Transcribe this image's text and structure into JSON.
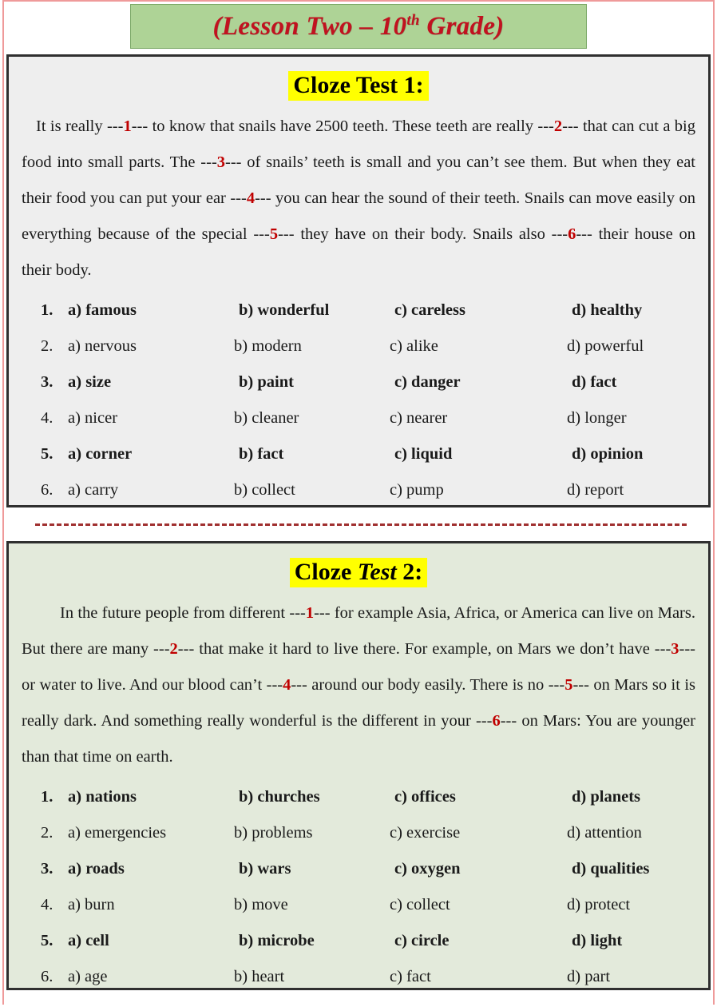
{
  "page": {
    "title_prefix": "(Lesson Two – 10",
    "title_sup": "th",
    "title_suffix": " Grade)"
  },
  "test1": {
    "heading_part1": "Cloze Test 1:",
    "passage": [
      {
        "t": "It is really ---"
      },
      {
        "n": "1"
      },
      {
        "t": "--- to know that snails have 2500 teeth. These teeth are really ---"
      },
      {
        "n": "2"
      },
      {
        "t": "--- that can cut a big food into small parts. The ---"
      },
      {
        "n": "3"
      },
      {
        "t": "--- of snails’ teeth is small and you can’t see them. But when they eat their food you can put your ear ---"
      },
      {
        "n": "4"
      },
      {
        "t": "--- you can hear the sound of their teeth. Snails can move easily on everything because of the special ---"
      },
      {
        "n": "5"
      },
      {
        "t": "--- they have on their body. Snails also ---"
      },
      {
        "n": "6"
      },
      {
        "t": "--- their house on their body."
      }
    ],
    "options": [
      {
        "num": "1.",
        "bold": true,
        "a": "a) famous",
        "b": "b) wonderful",
        "c": "c) careless",
        "d": "d) healthy"
      },
      {
        "num": "2.",
        "bold": false,
        "a": "a) nervous",
        "b": "b) modern",
        "c": "c) alike",
        "d": "d) powerful"
      },
      {
        "num": "3.",
        "bold": true,
        "a": "a) size",
        "b": "b) paint",
        "c": "c) danger",
        "d": "d) fact"
      },
      {
        "num": "4.",
        "bold": false,
        "a": "a) nicer",
        "b": "b) cleaner",
        "c": "c) nearer",
        "d": "d) longer"
      },
      {
        "num": "5.",
        "bold": true,
        "a": "a) corner",
        "b": "b) fact",
        "c": "c) liquid",
        "d": "d) opinion"
      },
      {
        "num": "6.",
        "bold": false,
        "a": "a) carry",
        "b": "b) collect",
        "c": "c) pump",
        "d": "d) report"
      }
    ]
  },
  "test2": {
    "heading_word1": "Cloze ",
    "heading_word2": "Test",
    "heading_word3": " 2:",
    "passage": [
      {
        "t": "In the future people from different ---"
      },
      {
        "n": "1"
      },
      {
        "t": "--- for example Asia, Africa, or America can live on Mars. But there are many ---"
      },
      {
        "n": "2"
      },
      {
        "t": "--- that make it hard to live there. For example, on Mars we don’t have ---"
      },
      {
        "n": "3"
      },
      {
        "t": "--- or water to live. And our blood can’t ---"
      },
      {
        "n": "4"
      },
      {
        "t": "--- around our body easily. There is no ---"
      },
      {
        "n": "5"
      },
      {
        "t": "--- on Mars so it is really dark. And something really wonderful is the different in your ---"
      },
      {
        "n": "6"
      },
      {
        "t": "--- on Mars: You are younger than that time on earth."
      }
    ],
    "options": [
      {
        "num": "1.",
        "bold": true,
        "a": "a) nations",
        "b": "b) churches",
        "c": "c) offices",
        "d": "d) planets"
      },
      {
        "num": "2.",
        "bold": false,
        "a": "a) emergencies",
        "b": "b) problems",
        "c": "c) exercise",
        "d": "d) attention"
      },
      {
        "num": "3.",
        "bold": true,
        "a": "a) roads",
        "b": "b) wars",
        "c": "c) oxygen",
        "d": "d) qualities"
      },
      {
        "num": "4.",
        "bold": false,
        "a": "a) burn",
        "b": "b) move",
        "c": "c) collect",
        "d": "d) protect"
      },
      {
        "num": "5.",
        "bold": true,
        "a": "a) cell",
        "b": "b) microbe",
        "c": "c) circle",
        "d": "d) light"
      },
      {
        "num": "6.",
        "bold": false,
        "a": "a) age",
        "b": "b) heart",
        "c": "c) fact",
        "d": "d) part"
      }
    ]
  },
  "colors": {
    "banner_bg": "#aed396",
    "title_red": "#c1121f",
    "highlight_yellow": "#ffff00",
    "blank_red": "#c00000",
    "box_gray": "#eeeeee",
    "box_green": "#e3eadb",
    "frame_pink": "#ef9a9a",
    "divider_red": "#a03030"
  }
}
